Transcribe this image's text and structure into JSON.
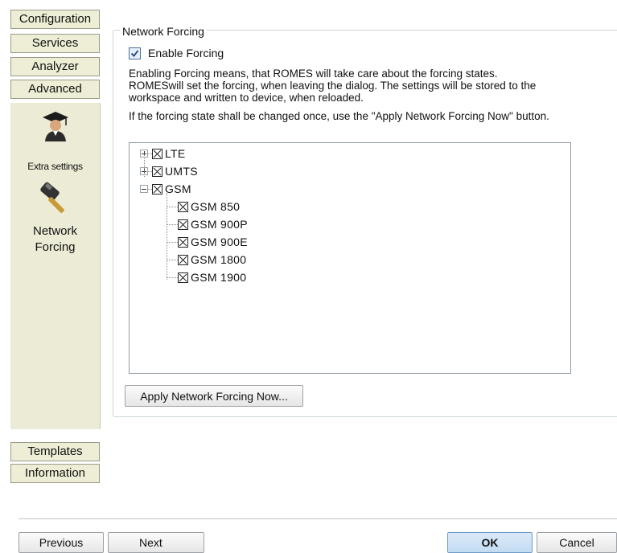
{
  "nav": {
    "tabs_top": [
      "Configuration",
      "Services",
      "Analyzer",
      "Advanced"
    ],
    "items": [
      {
        "label": "Extra settings",
        "icon": "graduate-icon"
      },
      {
        "label": "Network Forcing",
        "icon": "hammer-icon"
      }
    ],
    "tabs_bottom": [
      "Templates",
      "Information"
    ]
  },
  "group": {
    "title": "Network Forcing",
    "enable_label": "Enable Forcing",
    "enable_checked": true,
    "description": [
      "Enabling Forcing means, that ROMES will take care about the forcing states.",
      "ROMESwill set the forcing, when leaving the dialog. The settings will be stored to the",
      "workspace and written to device, when reloaded.",
      "If the forcing state shall be changed once, use the \"Apply Network Forcing Now\" button."
    ],
    "tree": [
      {
        "label": "LTE",
        "expanded": false,
        "children": []
      },
      {
        "label": "UMTS",
        "expanded": false,
        "children": []
      },
      {
        "label": "GSM",
        "expanded": true,
        "children": [
          "GSM 850",
          "GSM 900P",
          "GSM 900E",
          "GSM 1800",
          "GSM 1900"
        ]
      }
    ],
    "apply_button": "Apply Network Forcing Now..."
  },
  "footer": {
    "previous": "Previous",
    "next": "Next",
    "ok": "OK",
    "cancel": "Cancel"
  }
}
